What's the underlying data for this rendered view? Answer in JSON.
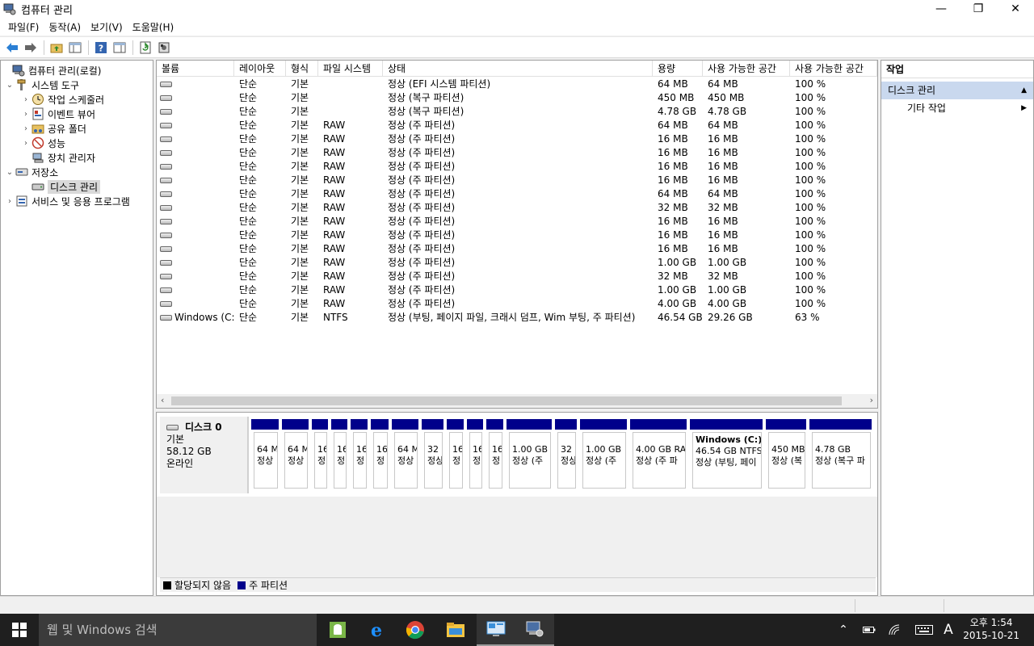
{
  "window": {
    "title": "컴퓨터 관리",
    "minimize": "—",
    "restore": "❐",
    "close": "✕"
  },
  "menu": [
    "파일(F)",
    "동작(A)",
    "보기(V)",
    "도움말(H)"
  ],
  "toolbar_icons": [
    "back-arrow-icon",
    "forward-arrow-icon",
    "up-folder-icon",
    "show-hide-tree-icon",
    "help-icon",
    "properties-pane-icon",
    "refresh-icon",
    "settings-icon"
  ],
  "tree": {
    "root": "컴퓨터 관리(로컬)",
    "system_tools": "시스템 도구",
    "task_scheduler": "작업 스케줄러",
    "event_viewer": "이벤트 뷰어",
    "shared_folders": "공유 폴더",
    "performance": "성능",
    "device_manager": "장치 관리자",
    "storage": "저장소",
    "disk_management": "디스크 관리",
    "services": "서비스 및 응용 프로그램"
  },
  "columns": [
    "볼륨",
    "레이아웃",
    "형식",
    "파일 시스템",
    "상태",
    "용량",
    "사용 가능한 공간",
    "사용 가능한 공간"
  ],
  "volumes": [
    {
      "name": "",
      "layout": "단순",
      "type": "기본",
      "fs": "",
      "status": "정상 (EFI 시스템 파티션)",
      "cap": "64 MB",
      "free": "64 MB",
      "pct": "100 %"
    },
    {
      "name": "",
      "layout": "단순",
      "type": "기본",
      "fs": "",
      "status": "정상 (복구 파티션)",
      "cap": "450 MB",
      "free": "450 MB",
      "pct": "100 %"
    },
    {
      "name": "",
      "layout": "단순",
      "type": "기본",
      "fs": "",
      "status": "정상 (복구 파티션)",
      "cap": "4.78 GB",
      "free": "4.78 GB",
      "pct": "100 %"
    },
    {
      "name": "",
      "layout": "단순",
      "type": "기본",
      "fs": "RAW",
      "status": "정상 (주 파티션)",
      "cap": "64 MB",
      "free": "64 MB",
      "pct": "100 %"
    },
    {
      "name": "",
      "layout": "단순",
      "type": "기본",
      "fs": "RAW",
      "status": "정상 (주 파티션)",
      "cap": "16 MB",
      "free": "16 MB",
      "pct": "100 %"
    },
    {
      "name": "",
      "layout": "단순",
      "type": "기본",
      "fs": "RAW",
      "status": "정상 (주 파티션)",
      "cap": "16 MB",
      "free": "16 MB",
      "pct": "100 %"
    },
    {
      "name": "",
      "layout": "단순",
      "type": "기본",
      "fs": "RAW",
      "status": "정상 (주 파티션)",
      "cap": "16 MB",
      "free": "16 MB",
      "pct": "100 %"
    },
    {
      "name": "",
      "layout": "단순",
      "type": "기본",
      "fs": "RAW",
      "status": "정상 (주 파티션)",
      "cap": "16 MB",
      "free": "16 MB",
      "pct": "100 %"
    },
    {
      "name": "",
      "layout": "단순",
      "type": "기본",
      "fs": "RAW",
      "status": "정상 (주 파티션)",
      "cap": "64 MB",
      "free": "64 MB",
      "pct": "100 %"
    },
    {
      "name": "",
      "layout": "단순",
      "type": "기본",
      "fs": "RAW",
      "status": "정상 (주 파티션)",
      "cap": "32 MB",
      "free": "32 MB",
      "pct": "100 %"
    },
    {
      "name": "",
      "layout": "단순",
      "type": "기본",
      "fs": "RAW",
      "status": "정상 (주 파티션)",
      "cap": "16 MB",
      "free": "16 MB",
      "pct": "100 %"
    },
    {
      "name": "",
      "layout": "단순",
      "type": "기본",
      "fs": "RAW",
      "status": "정상 (주 파티션)",
      "cap": "16 MB",
      "free": "16 MB",
      "pct": "100 %"
    },
    {
      "name": "",
      "layout": "단순",
      "type": "기본",
      "fs": "RAW",
      "status": "정상 (주 파티션)",
      "cap": "16 MB",
      "free": "16 MB",
      "pct": "100 %"
    },
    {
      "name": "",
      "layout": "단순",
      "type": "기본",
      "fs": "RAW",
      "status": "정상 (주 파티션)",
      "cap": "1.00 GB",
      "free": "1.00 GB",
      "pct": "100 %"
    },
    {
      "name": "",
      "layout": "단순",
      "type": "기본",
      "fs": "RAW",
      "status": "정상 (주 파티션)",
      "cap": "32 MB",
      "free": "32 MB",
      "pct": "100 %"
    },
    {
      "name": "",
      "layout": "단순",
      "type": "기본",
      "fs": "RAW",
      "status": "정상 (주 파티션)",
      "cap": "1.00 GB",
      "free": "1.00 GB",
      "pct": "100 %"
    },
    {
      "name": "",
      "layout": "단순",
      "type": "기본",
      "fs": "RAW",
      "status": "정상 (주 파티션)",
      "cap": "4.00 GB",
      "free": "4.00 GB",
      "pct": "100 %"
    },
    {
      "name": "Windows (C:)",
      "layout": "단순",
      "type": "기본",
      "fs": "NTFS",
      "status": "정상 (부팅, 페이지 파일, 크래시 덤프, Wim 부팅, 주 파티션)",
      "cap": "46.54 GB",
      "free": "29.26 GB",
      "pct": "63 %"
    }
  ],
  "disk": {
    "name": "디스크 0",
    "type": "기본",
    "size": "58.12 GB",
    "status": "온라인"
  },
  "partitions": [
    {
      "title": "",
      "l1": "64 MB",
      "l2": "정상"
    },
    {
      "title": "",
      "l1": "64 MB",
      "l2": "정상"
    },
    {
      "title": "",
      "l1": "16",
      "l2": "정"
    },
    {
      "title": "",
      "l1": "16",
      "l2": "정"
    },
    {
      "title": "",
      "l1": "16",
      "l2": "정"
    },
    {
      "title": "",
      "l1": "16",
      "l2": "정"
    },
    {
      "title": "",
      "l1": "64 MB",
      "l2": "정상"
    },
    {
      "title": "",
      "l1": "32",
      "l2": "정상"
    },
    {
      "title": "",
      "l1": "16",
      "l2": "정"
    },
    {
      "title": "",
      "l1": "16",
      "l2": "정"
    },
    {
      "title": "",
      "l1": "16",
      "l2": "정"
    },
    {
      "title": "",
      "l1": "1.00 GB",
      "l2": "정상 (주"
    },
    {
      "title": "",
      "l1": "32",
      "l2": "정상"
    },
    {
      "title": "",
      "l1": "1.00 GB",
      "l2": "정상 (주"
    },
    {
      "title": "",
      "l1": "4.00 GB RAW",
      "l2": "정상 (주 파"
    },
    {
      "title": "Windows (C:)",
      "l1": "46.54 GB NTFS",
      "l2": "정상 (부팅, 페이"
    },
    {
      "title": "",
      "l1": "450 MB",
      "l2": "정상 (복"
    },
    {
      "title": "",
      "l1": "4.78 GB",
      "l2": "정상 (복구 파"
    }
  ],
  "legend": {
    "unallocated": "할당되지 않음",
    "primary": "주 파티션",
    "unallocated_color": "#000000",
    "primary_color": "#00008b"
  },
  "actions": {
    "header": "작업",
    "section": "디스크 관리",
    "more": "기타 작업"
  },
  "taskbar": {
    "search_placeholder": "웹 및 Windows 검색",
    "apps": [
      "android-icon",
      "internet-explorer-icon",
      "chrome-icon",
      "file-explorer-icon",
      "remote-desktop-icon",
      "computer-management-icon"
    ],
    "ime": "A",
    "time": "오후 1:54",
    "date": "2015-10-21"
  }
}
